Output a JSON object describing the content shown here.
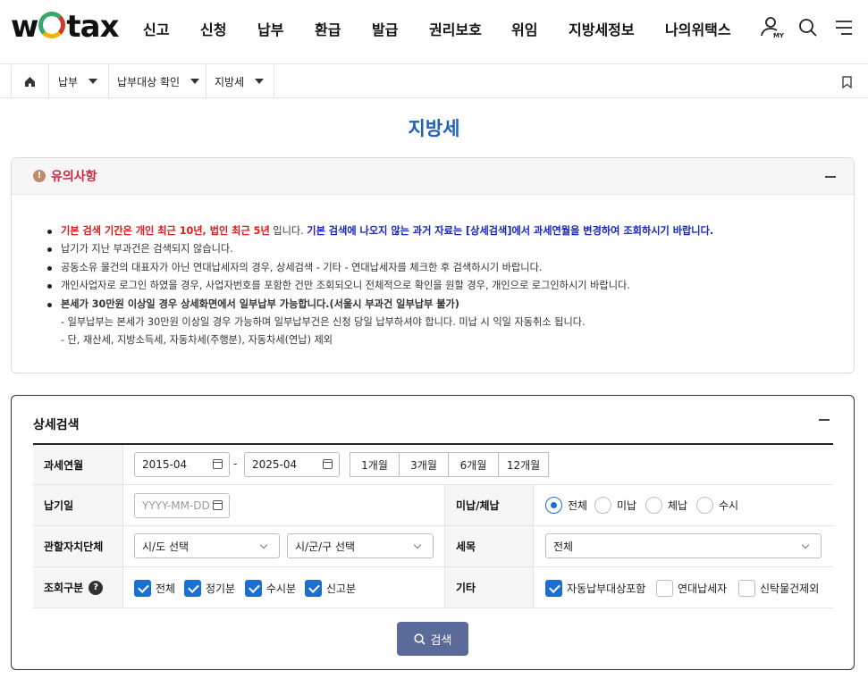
{
  "header": {
    "logo_text": "wetax",
    "nav": [
      "신고",
      "신청",
      "납부",
      "환급",
      "발급",
      "권리보호",
      "위임",
      "지방세정보",
      "나의위택스"
    ],
    "my_label": "MY"
  },
  "breadcrumb": {
    "items": [
      "납부",
      "납부대상 확인",
      "지방세"
    ]
  },
  "page_title": "지방세",
  "notice": {
    "title": "유의사항",
    "line1_red": "기본 검색 기간은 개인 최근 10년, 법인 최근 5년",
    "line1_mid": " 입니다. ",
    "line1_blue": "기본 검색에 나오지 않는 과거 자료는 [상세검색]에서 과세연월을 변경하여 조회하시기 바랍니다.",
    "line2": "납기가 지난 부과건은 검색되지 않습니다.",
    "line3": "공동소유 물건의 대표자가 아닌 연대납세자의 경우, 상세검색 - 기타 - 연대납세자를 체크한 후 검색하시기 바랍니다.",
    "line4": "개인사업자로 로그인 하였을 경우, 사업자번호를 포함한 건만 조회되오니 전체적으로 확인을 원할 경우, 개인으로 로그인하시기 바랍니다.",
    "line5_blue": "본세가 30만원 이상일 경우 상세화면에서 일부납부 가능합니다.(서울시 부과건 일부납부 불가)",
    "sub1": "- 일부납부는 본세가 30만원 이상일 경우 가능하며 일부납부건은 신청 당일 납부하셔야 합니다. 미납 시 익일 자동취소 됩니다.",
    "sub2": "- 단, 재산세, 지방소득세, 자동차세(주행분), 자동차세(연납) 제외"
  },
  "search": {
    "title": "상세검색",
    "period_label": "과세연월",
    "period_from": "2015-04",
    "period_sep": "-",
    "period_to": "2025-04",
    "period_buttons": [
      "1개월",
      "3개월",
      "6개월",
      "12개월"
    ],
    "due_label": "납기일",
    "due_placeholder": "YYYY-MM-DD",
    "unpaid_label": "미납/체납",
    "unpaid_options": [
      "전체",
      "미납",
      "체납",
      "수시"
    ],
    "unpaid_selected": "전체",
    "region_label": "관할자치단체",
    "region_sido": "시/도 선택",
    "region_sigungu": "시/군/구 선택",
    "tax_label": "세목",
    "tax_value": "전체",
    "type_label": "조회구분",
    "type_help": "?",
    "type_options": [
      "전체",
      "정기분",
      "수시분",
      "신고분"
    ],
    "etc_label": "기타",
    "etc_options": [
      "자동납부대상포함",
      "연대납세자",
      "신탁물건제외"
    ],
    "submit_label": "검색"
  },
  "colors": {
    "brand_blue": "#1e62b8",
    "accent_red": "#d4243d",
    "checkbox_blue": "#1a6fd3",
    "button_bg": "#5a6b9a"
  }
}
